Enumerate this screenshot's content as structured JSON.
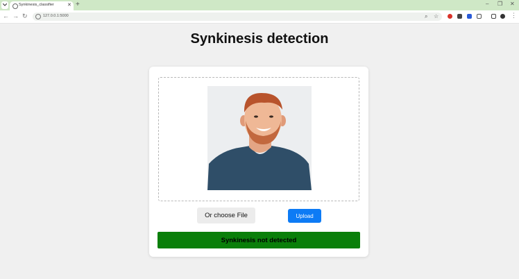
{
  "browser": {
    "tab_title": "Synkinesis_classifier",
    "url": "127.0.0.1:5000",
    "new_tab_icon": "plus-icon",
    "window_controls": [
      "minimize-icon",
      "restore-icon",
      "close-icon"
    ]
  },
  "page": {
    "title": "Synkinesis detection",
    "choose_file_label": "Or choose File",
    "upload_label": "Upload",
    "result_text": "Synkinesis not detected",
    "result_color": "#0a7f0a",
    "upload_color": "#0d7bf5"
  }
}
